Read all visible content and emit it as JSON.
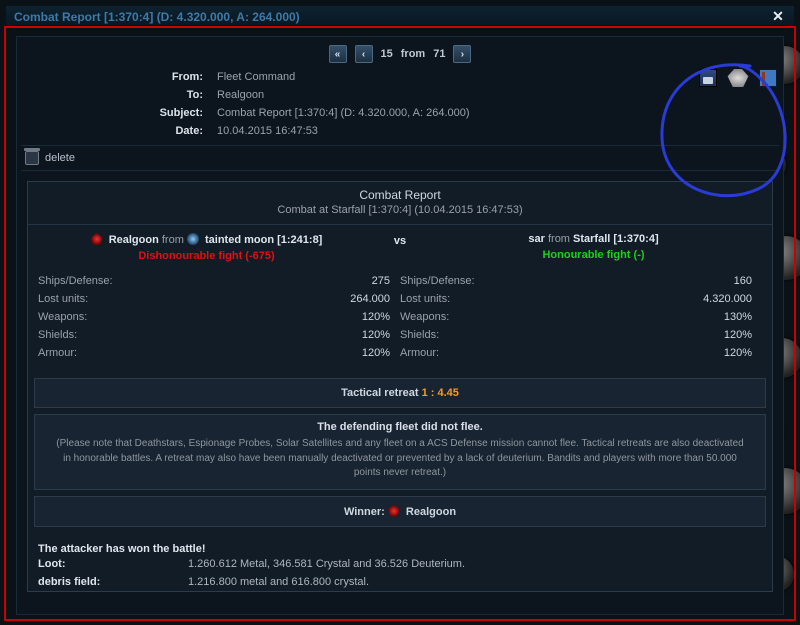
{
  "titlebar": {
    "title": "Combat Report [1:370:4] (D: 4.320.000, A: 264.000)"
  },
  "pager": {
    "current": "15",
    "sep": "from",
    "total": "71"
  },
  "meta": {
    "labels": {
      "from": "From:",
      "to": "To:",
      "subject": "Subject:",
      "date": "Date:"
    },
    "from": "Fleet Command",
    "to": "Realgoon",
    "subject": "Combat Report [1:370:4] (D: 4.320.000, A: 264.000)",
    "date": "10.04.2015 16:47:53"
  },
  "actions": {
    "delete": "delete"
  },
  "report": {
    "heading": "Combat Report",
    "subheading": "Combat at Starfall [1:370:4] (10.04.2015 16:47:53)",
    "vs": "vs",
    "attacker": {
      "name": "Realgoon",
      "from_word": "from",
      "origin": "tainted moon [1:241:8]",
      "honor_label": "Dishonourable fight",
      "honor_value": "(-675)",
      "stats_labels": [
        "Ships/Defense:",
        "Lost units:",
        "Weapons:",
        "Shields:",
        "Armour:"
      ],
      "stats_values": [
        "275",
        "264.000",
        "120%",
        "120%",
        "120%"
      ]
    },
    "defender": {
      "name": "sar",
      "from_word": "from",
      "origin": "Starfall [1:370:4]",
      "honor_label": "Honourable fight",
      "honor_value": "(-)",
      "stats_labels": [
        "Ships/Defense:",
        "Lost units:",
        "Weapons:",
        "Shields:",
        "Armour:"
      ],
      "stats_values": [
        "160",
        "4.320.000",
        "130%",
        "120%",
        "120%"
      ]
    },
    "retreat": {
      "label": "Tactical retreat",
      "value": "1 : 4.45"
    },
    "noflee": {
      "title": "The defending fleet did not flee.",
      "text": "(Please note that Deathstars, Espionage Probes, Solar Satellites and any fleet on a ACS Defense mission cannot flee. Tactical retreats are also deactivated in honorable battles. A retreat may also have been manually deactivated or prevented by a lack of deuterium. Bandits and players with more than 50.000 points never retreat.)"
    },
    "winner": {
      "label": "Winner:",
      "name": "Realgoon"
    },
    "result": {
      "headline": "The attacker has won the battle!",
      "loot_label": "Loot:",
      "loot_value": "1.260.612 Metal, 346.581 Crystal and 36.526 Deuterium.",
      "debris_label": "debris field:",
      "debris_value": "1.216.800 metal and 616.800 crystal."
    }
  },
  "icons": {
    "save": "disk-icon",
    "sim": "ships-icon",
    "share": "flag-icon"
  }
}
